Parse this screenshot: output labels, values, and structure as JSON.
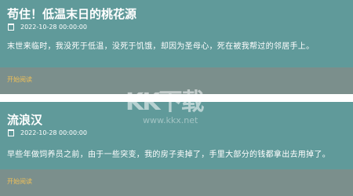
{
  "articles": [
    {
      "title": "苟住！低温末日的桃花源",
      "date": "2022-10-28 00:00:00",
      "excerpt": "末世来临时，我没死于低温，没死于饥饿，却因为圣母心，死在被我帮过的邻居手上。",
      "read_label": "开始阅读"
    },
    {
      "title": "流浪汉",
      "date": "2022-10-28 00:00:00",
      "excerpt": "早些年做饲养员之前，由于一些突变，我的房子卖掉了，手里大部分的钱都拿出去用掉了。",
      "read_label": "开始阅读"
    }
  ],
  "watermark": {
    "logo": "KK下载",
    "url": "www.kkx.net"
  },
  "colors": {
    "card_bg": "#609a9a",
    "footer_bg": "#7b8f8c",
    "link": "#f0c058",
    "text": "#ffffff"
  },
  "icons": {
    "date": "calendar-icon"
  }
}
